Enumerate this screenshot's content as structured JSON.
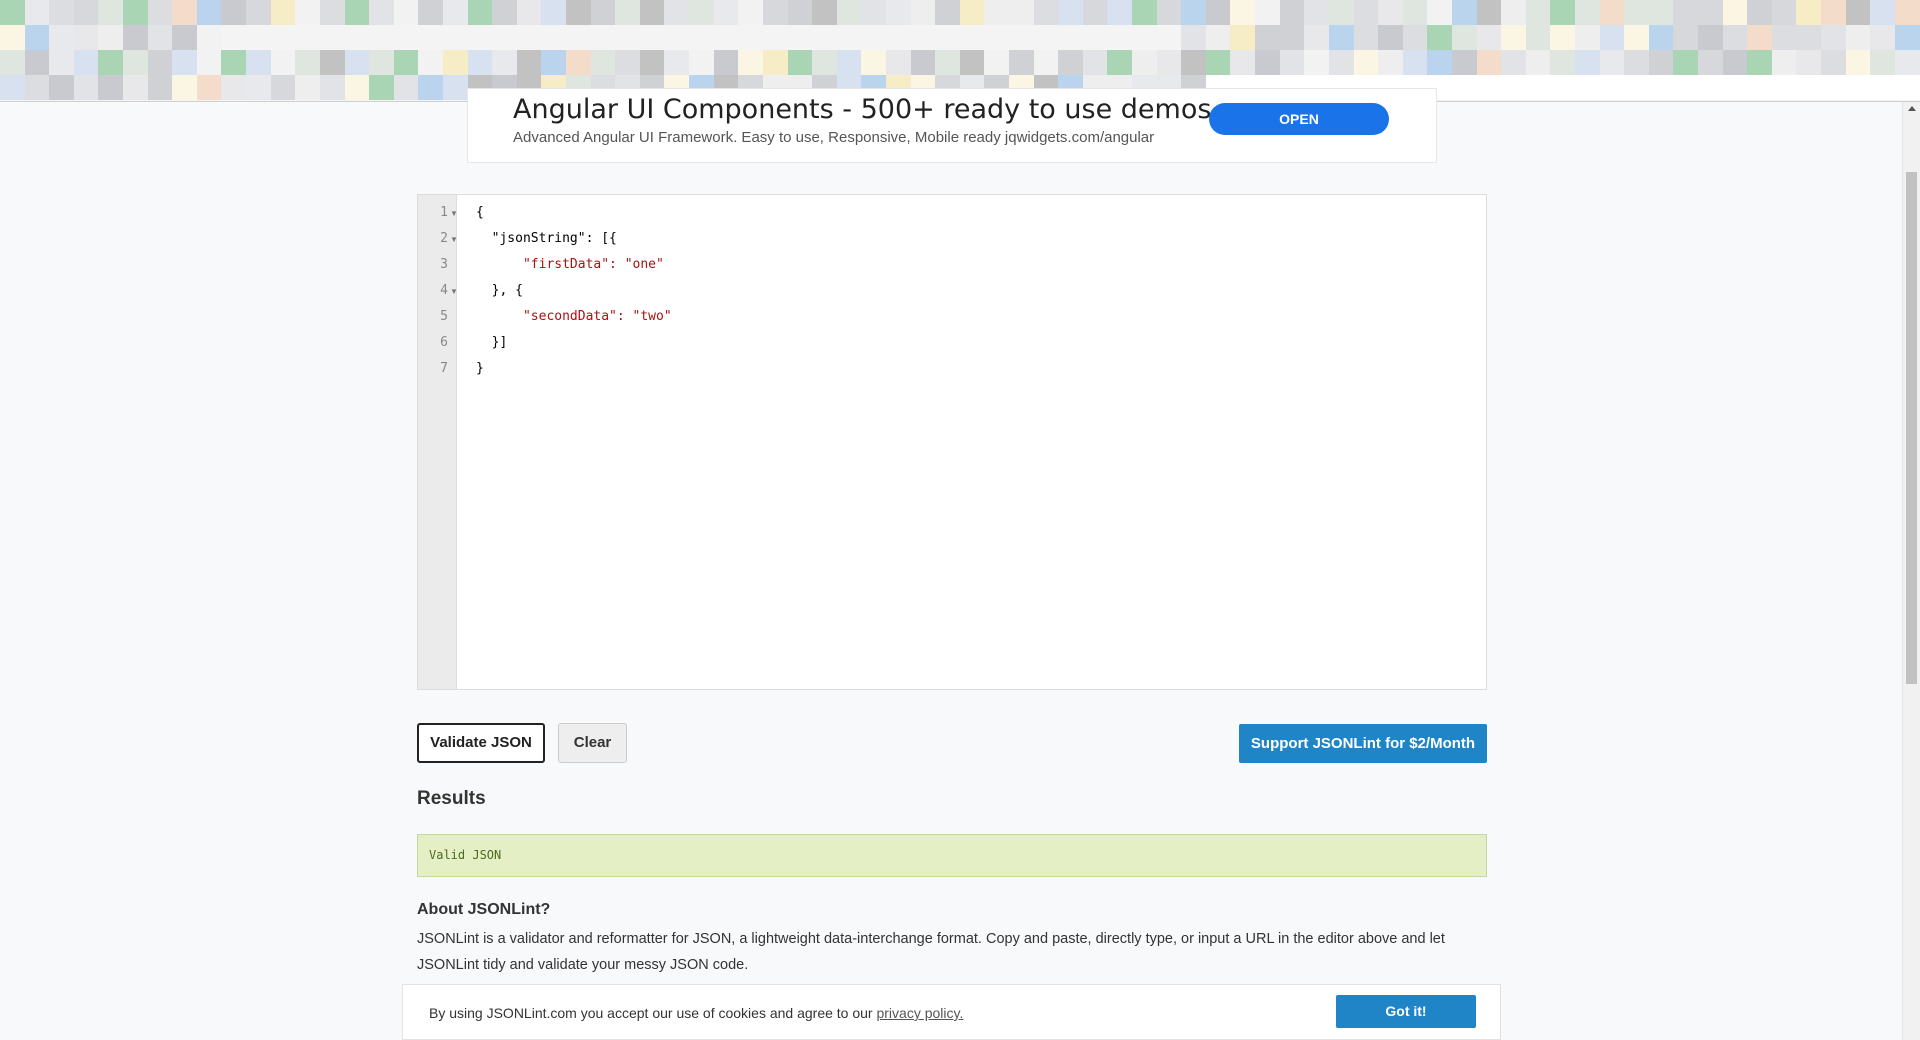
{
  "ad": {
    "title": "Angular UI Components - 500+ ready to use demos",
    "subtitle": "Advanced Angular UI Framework. Easy to use, Responsive, Mobile ready jqwidgets.com/angular",
    "button_label": "OPEN"
  },
  "editor": {
    "line_numbers": [
      "1",
      "2",
      "3",
      "4",
      "5",
      "6",
      "7"
    ],
    "lines": [
      "{",
      "  \"jsonString\": [{",
      "      \"firstData\": \"one\"",
      "  }, {",
      "      \"secondData\": \"two\"",
      "  }]",
      "}"
    ]
  },
  "buttons": {
    "validate_label": "Validate JSON",
    "clear_label": "Clear",
    "support_label": "Support JSONLint for $2/Month"
  },
  "results": {
    "heading": "Results",
    "message": "Valid JSON"
  },
  "about": {
    "heading": "About JSONLint?",
    "text": "JSONLint is a validator and reformatter for JSON, a lightweight data-interchange format. Copy and paste, directly type, or input a URL in the editor above and let JSONLint tidy and validate your messy JSON code."
  },
  "cookie": {
    "text": "By using JSONLint.com you accept our use of cookies and agree to our ",
    "link_label": "privacy policy.",
    "button_label": "Got it!"
  },
  "colors": {
    "accent": "#1f85c7",
    "ad_button": "#1a73e8",
    "success_bg": "#e4efc5"
  }
}
